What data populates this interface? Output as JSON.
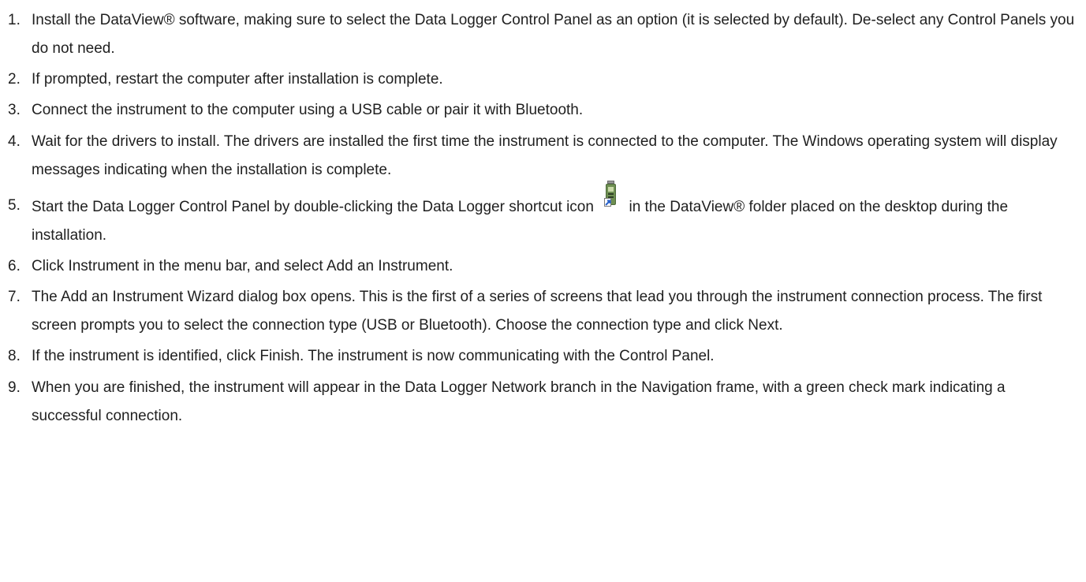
{
  "steps": [
    {
      "num": "1.",
      "text": "Install the DataView® software, making sure to select the Data Logger Control Panel as an option (it is selected by default). De-select any Control Panels you do not need."
    },
    {
      "num": "2.",
      "text": "If prompted, restart the computer after installation is complete."
    },
    {
      "num": "3.",
      "text": "Connect the instrument to the computer using a USB cable or pair it with Bluetooth."
    },
    {
      "num": "4.",
      "text": "Wait for the drivers to install. The drivers are installed the first time the instrument is connected to the computer. The Windows operating system will display messages indicating when the installation is complete."
    },
    {
      "num": "5.",
      "text_before": "Start the Data Logger Control Panel by double-clicking the Data Logger shortcut icon",
      "text_after": "in the DataView® folder placed on the desktop during the installation.",
      "icon": "data-logger-shortcut-icon"
    },
    {
      "num": "6.",
      "text": "Click Instrument in the menu bar, and select Add an Instrument."
    },
    {
      "num": "7.",
      "text": "The Add an Instrument Wizard dialog box opens. This is the first of a series of screens that lead you through the instrument connection process. The first screen prompts you to select the connection type (USB or Bluetooth). Choose the connection type and click Next."
    },
    {
      "num": "8.",
      "text": "If the instrument is identified, click Finish. The instrument is now communicating with the Control Panel."
    },
    {
      "num": "9.",
      "text": "When you are finished, the instrument will appear in the Data Logger Network branch in the Navigation frame, with a green check mark indicating a successful connection."
    }
  ]
}
